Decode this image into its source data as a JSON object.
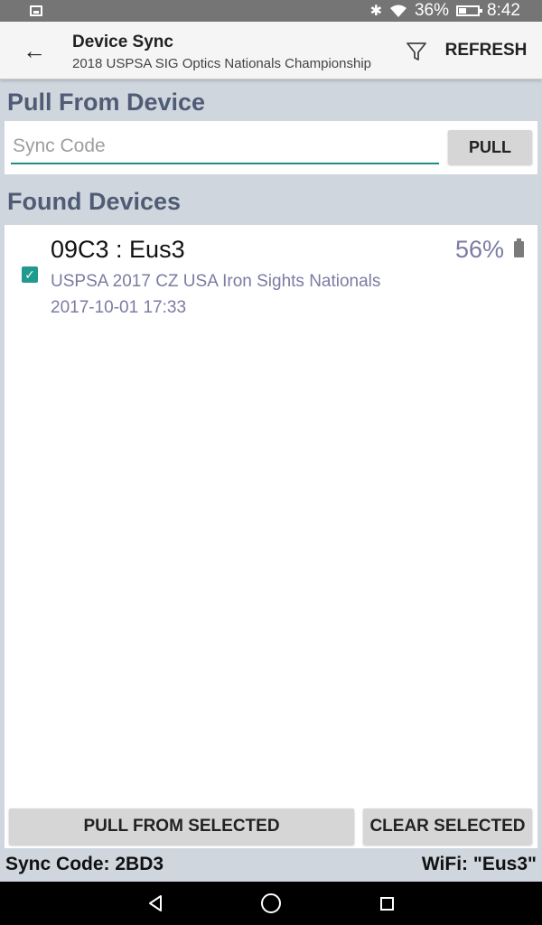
{
  "status_bar": {
    "battery_percent": "36%",
    "battery_level": 0.36,
    "time": "8:42",
    "icons": [
      "image-notification-icon",
      "bluetooth-icon",
      "wifi-icon",
      "battery-icon"
    ]
  },
  "toolbar": {
    "title": "Device Sync",
    "subtitle": "2018 USPSA SIG Optics Nationals Championship",
    "refresh_label": "REFRESH",
    "icons": [
      "back-arrow-icon",
      "filter-icon"
    ]
  },
  "pull_section": {
    "header": "Pull From Device",
    "input_placeholder": "Sync Code",
    "input_value": "",
    "pull_label": "PULL"
  },
  "found_section": {
    "header": "Found Devices",
    "devices": [
      {
        "name": "09C3 : Eus3",
        "match": "USPSA 2017 CZ USA Iron Sights Nationals",
        "date": "2017-10-01 17:33",
        "battery": "56%",
        "selected": true
      }
    ]
  },
  "actions": {
    "pull_from_selected": "PULL FROM SELECTED",
    "clear_selected": "CLEAR SELECTED"
  },
  "footer": {
    "sync_code": "Sync Code: 2BD3",
    "wifi": "WiFi: \"Eus3\""
  },
  "colors": {
    "accent": "#1f9a8e",
    "header_text": "#505c75",
    "secondary_text": "#7b7ba3",
    "background": "#cfd6de"
  }
}
